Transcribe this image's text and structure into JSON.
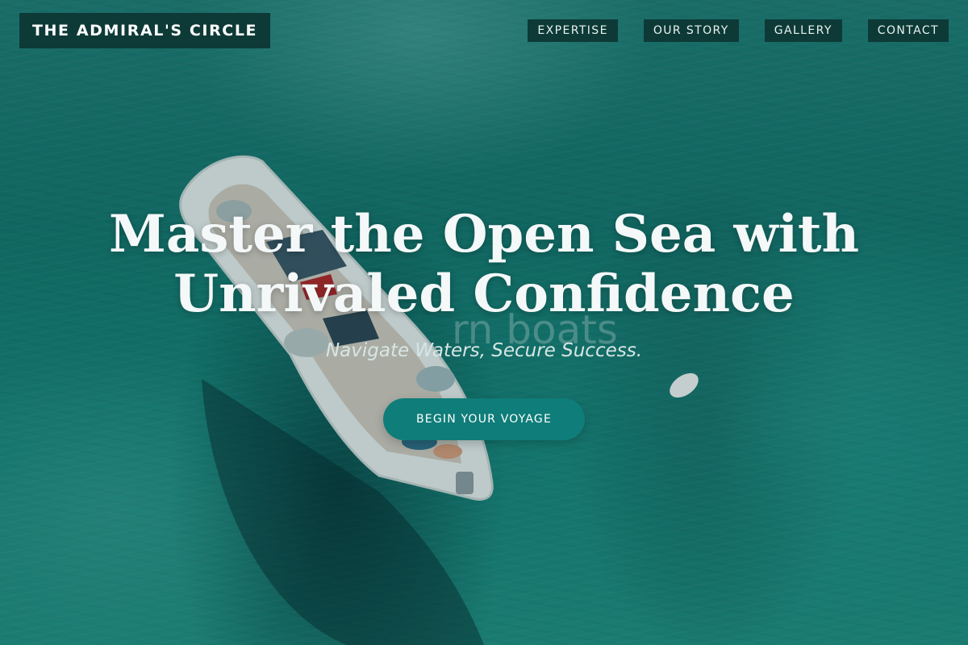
{
  "brand": {
    "name": "THE ADMIRAL'S CIRCLE"
  },
  "nav": {
    "items": [
      {
        "label": "EXPERTISE"
      },
      {
        "label": "OUR STORY"
      },
      {
        "label": "GALLERY"
      },
      {
        "label": "CONTACT"
      }
    ]
  },
  "hero": {
    "title": "Master the Open Sea with Unrivaled Confidence",
    "ghost_text": "rn boats",
    "subtitle": "Navigate Waters, Secure Success.",
    "cta_label": "BEGIN YOUR VOYAGE",
    "background_image": "aerial-ocean-boat-photo"
  },
  "colors": {
    "accent": "#0f7d79",
    "nav_bg": "#0d3a37",
    "text": "#f4f8f8"
  }
}
